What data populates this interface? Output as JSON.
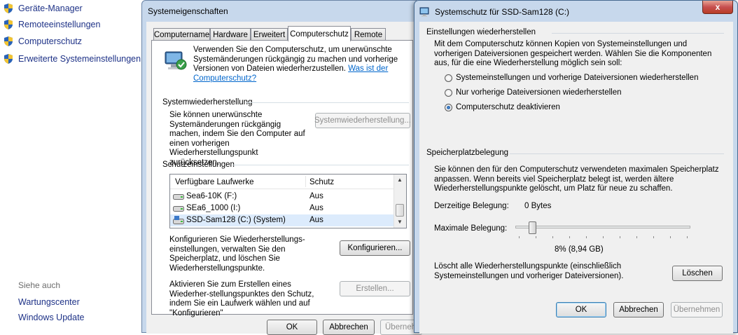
{
  "control_panel": {
    "links": [
      "Geräte-Manager",
      "Remoteeinstellungen",
      "Computerschutz",
      "Erweiterte Systemeinstellungen"
    ],
    "see_also_heading": "Siehe auch",
    "see_also_links": [
      "Wartungscenter",
      "Windows Update"
    ]
  },
  "system_properties": {
    "title": "Systemeigenschaften",
    "tabs": [
      "Computername",
      "Hardware",
      "Erweitert",
      "Computerschutz",
      "Remote"
    ],
    "intro_text": "Verwenden Sie den Computerschutz, um unerwünschte Systemänderungen rückgängig zu machen und vorherige Versionen von Dateien wiederherzustellen.",
    "intro_link": "Was ist der Computerschutz?",
    "restore_heading": "Systemwiederherstellung",
    "restore_text": "Sie können unerwünschte Systemänderungen rückgängig machen, indem Sie den Computer auf einen vorherigen Wiederherstellungspunkt zurücksetzen.",
    "restore_button": "Systemwiederherstellung...",
    "protection_heading": "Schutzeinstellungen",
    "list_columns": [
      "Verfügbare Laufwerke",
      "Schutz"
    ],
    "drives": [
      {
        "name": "Sea6-10K (F:)",
        "status": "Aus"
      },
      {
        "name": "SEa6_1000 (I:)",
        "status": "Aus"
      },
      {
        "name": "SSD-Sam128 (C:) (System)",
        "status": "Aus"
      }
    ],
    "configure_text": "Konfigurieren Sie Wiederherstellungs-einstellungen, verwalten Sie den Speicherplatz, und löschen Sie Wiederherstellungspunkte.",
    "configure_button": "Konfigurieren...",
    "create_text": "Aktivieren Sie zum Erstellen eines Wiederher-stellungspunktes den Schutz, indem Sie ein Laufwerk wählen und auf \"Konfigurieren\"",
    "create_button": "Erstellen...",
    "ok_button": "OK",
    "cancel_button": "Abbrechen",
    "apply_button": "Überneh"
  },
  "system_protection_dialog": {
    "title": "Systemschutz für SSD-Sam128 (C:)",
    "close_label": "x",
    "restore_settings_heading": "Einstellungen wiederherstellen",
    "restore_settings_text": "Mit dem Computerschutz können Kopien von Systemeinstellungen und vorherigen Dateiversionen gespeichert werden. Wählen Sie die Komponenten aus, für die eine Wiederherstellung möglich sein soll:",
    "options": [
      {
        "label": "Systemeinstellungen und vorherige Dateiversionen wiederherstellen",
        "selected": false
      },
      {
        "label": "Nur vorherige Dateiversionen wiederherstellen",
        "selected": false
      },
      {
        "label": "Computerschutz deaktivieren",
        "selected": true
      }
    ],
    "disk_usage_heading": "Speicherplatzbelegung",
    "disk_usage_text": "Sie können den für den Computerschutz verwendeten maximalen Speicherplatz anpassen. Wenn bereits viel Speicherplatz belegt ist, werden ältere Wiederherstellungspunkte gelöscht, um Platz für neue zu schaffen.",
    "current_usage_label": "Derzeitige Belegung:",
    "current_usage_value": "0 Bytes",
    "max_usage_label": "Maximale Belegung:",
    "max_usage_fraction": 0.08,
    "max_usage_value": "8% (8,94 GB)",
    "delete_text": "Löscht alle Wiederherstellungspunkte (einschließlich Systemeinstellungen und vorheriger Dateiversionen).",
    "delete_button": "Löschen",
    "ok_button": "OK",
    "cancel_button": "Abbrechen",
    "apply_button": "Übernehmen"
  }
}
